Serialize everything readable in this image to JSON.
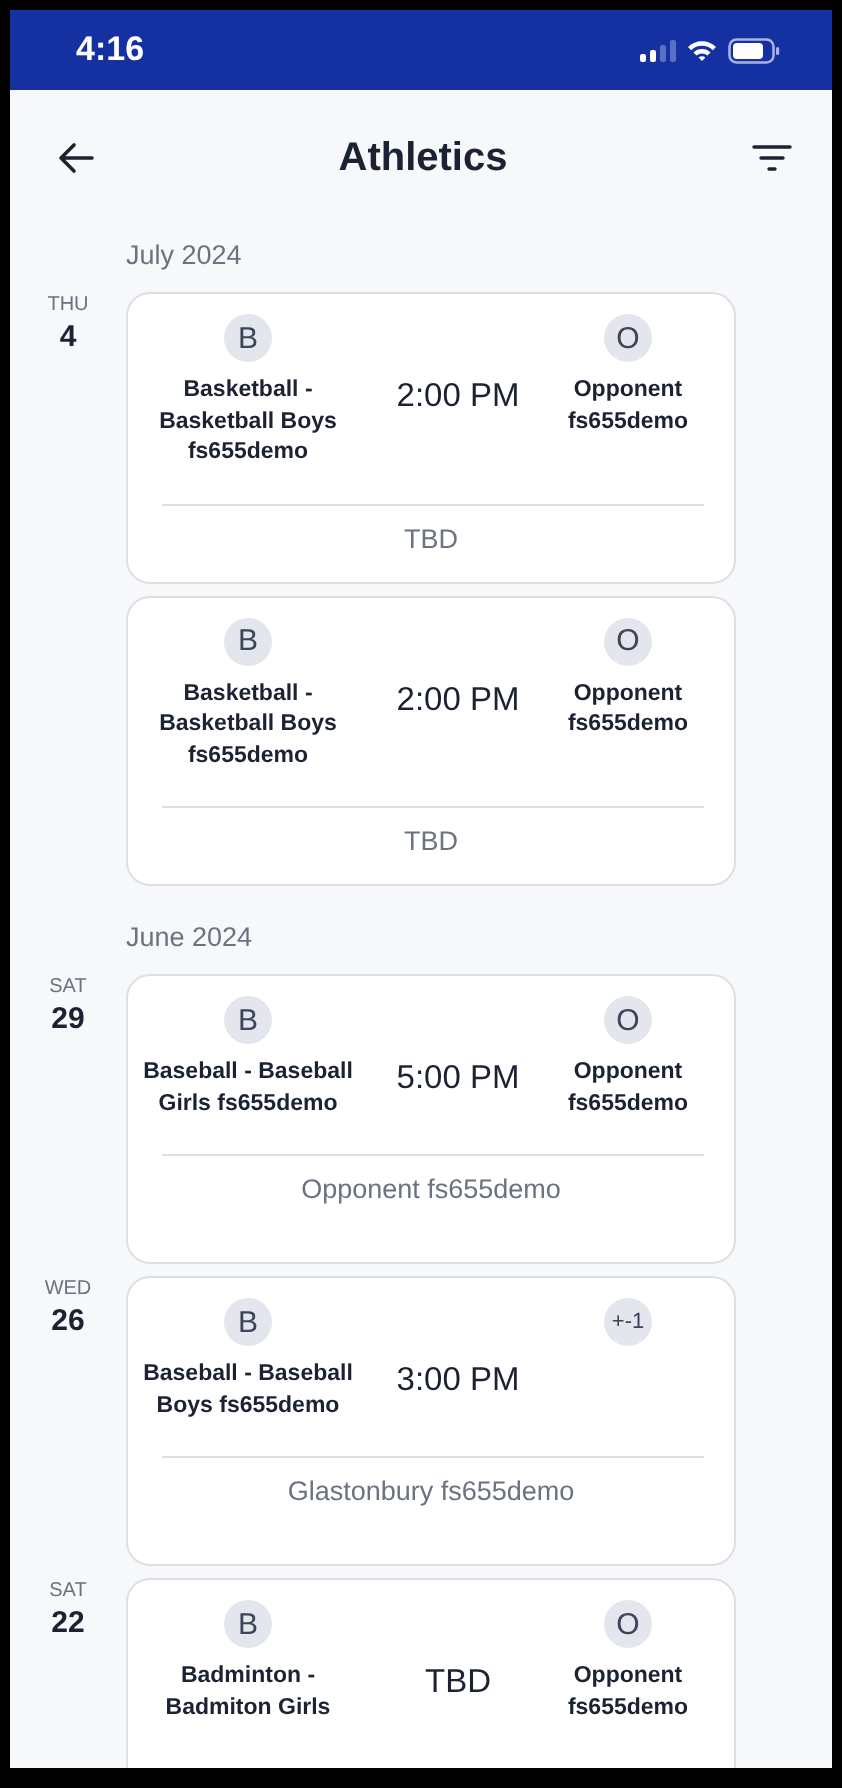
{
  "status_bar": {
    "time": "4:16"
  },
  "header": {
    "title": "Athletics"
  },
  "months": [
    {
      "label": "July 2024",
      "events": [
        {
          "day_name": "THU",
          "day_number": "4",
          "home": {
            "badge": "B",
            "name": "Basketball - Basketball Boys fs655demo"
          },
          "time": "2:00 PM",
          "away": {
            "badge": "O",
            "name": "Opponent fs655demo"
          },
          "location": "TBD"
        },
        {
          "home": {
            "badge": "B",
            "name": "Basketball - Basketball Boys fs655demo"
          },
          "time": "2:00 PM",
          "away": {
            "badge": "O",
            "name": "Opponent fs655demo"
          },
          "location": "TBD"
        }
      ]
    },
    {
      "label": "June 2024",
      "events": [
        {
          "day_name": "SAT",
          "day_number": "29",
          "home": {
            "badge": "B",
            "name": "Baseball - Baseball Girls fs655demo"
          },
          "time": "5:00 PM",
          "away": {
            "badge": "O",
            "name": "Opponent fs655demo"
          },
          "location": "Opponent fs655demo"
        },
        {
          "day_name": "WED",
          "day_number": "26",
          "home": {
            "badge": "B",
            "name": "Baseball - Baseball Boys fs655demo"
          },
          "time": "3:00 PM",
          "away": {
            "badge": "+-1"
          },
          "location": "Glastonbury fs655demo"
        },
        {
          "day_name": "SAT",
          "day_number": "22",
          "home": {
            "badge": "B",
            "name": "Badminton - Badmiton Girls"
          },
          "time": "TBD",
          "away": {
            "badge": "O",
            "name": "Opponent fs655demo"
          }
        }
      ]
    }
  ]
}
